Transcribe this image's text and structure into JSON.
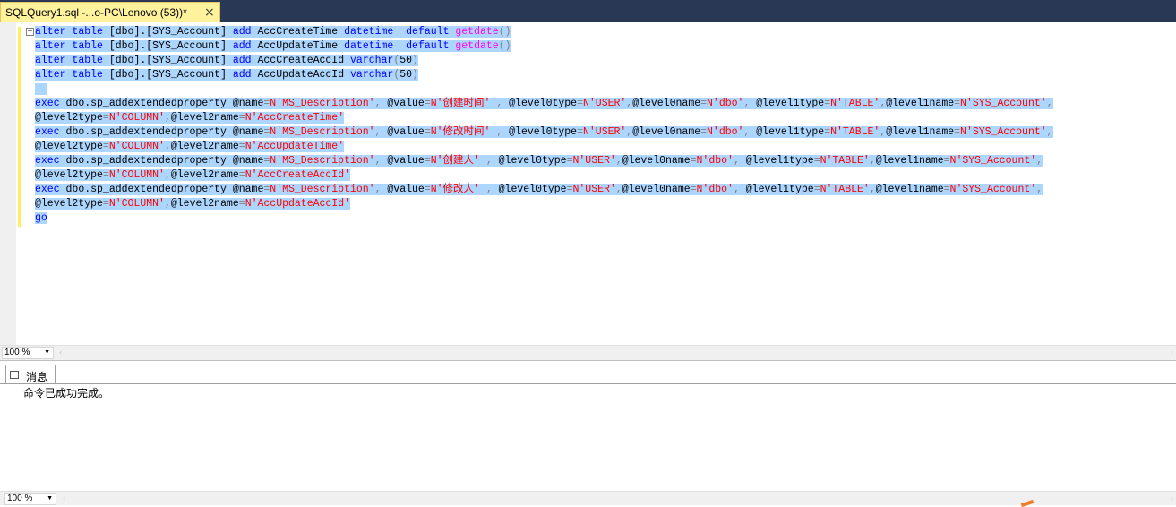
{
  "tab": {
    "title": "SQLQuery1.sql -...o-PC\\Lenovo (53))*",
    "close_glyph": "×"
  },
  "code_lines": [
    [
      [
        "kw",
        "alter"
      ],
      [
        "t",
        " "
      ],
      [
        "kw",
        "table"
      ],
      [
        "t",
        " [dbo]."
      ],
      [
        "t",
        "[SYS_Account] "
      ],
      [
        "kw",
        "add"
      ],
      [
        "t",
        " AccCreateTime "
      ],
      [
        "kw",
        "datetime"
      ],
      [
        "t",
        "  "
      ],
      [
        "kw",
        "default"
      ],
      [
        "t",
        " "
      ],
      [
        "fn",
        "getdate"
      ],
      [
        "op",
        "()"
      ]
    ],
    [
      [
        "kw",
        "alter"
      ],
      [
        "t",
        " "
      ],
      [
        "kw",
        "table"
      ],
      [
        "t",
        " [dbo]."
      ],
      [
        "t",
        "[SYS_Account] "
      ],
      [
        "kw",
        "add"
      ],
      [
        "t",
        " AccUpdateTime "
      ],
      [
        "kw",
        "datetime"
      ],
      [
        "t",
        "  "
      ],
      [
        "kw",
        "default"
      ],
      [
        "t",
        " "
      ],
      [
        "fn",
        "getdate"
      ],
      [
        "op",
        "()"
      ]
    ],
    [
      [
        "kw",
        "alter"
      ],
      [
        "t",
        " "
      ],
      [
        "kw",
        "table"
      ],
      [
        "t",
        " [dbo]."
      ],
      [
        "t",
        "[SYS_Account] "
      ],
      [
        "kw",
        "add"
      ],
      [
        "t",
        " AccCreateAccId "
      ],
      [
        "kw",
        "varchar"
      ],
      [
        "op",
        "("
      ],
      [
        "t",
        "50"
      ],
      [
        "op",
        ")"
      ]
    ],
    [
      [
        "kw",
        "alter"
      ],
      [
        "t",
        " "
      ],
      [
        "kw",
        "table"
      ],
      [
        "t",
        " [dbo]."
      ],
      [
        "t",
        "[SYS_Account] "
      ],
      [
        "kw",
        "add"
      ],
      [
        "t",
        " AccUpdateAccId "
      ],
      [
        "kw",
        "varchar"
      ],
      [
        "op",
        "("
      ],
      [
        "t",
        "50"
      ],
      [
        "op",
        ")"
      ]
    ],
    [
      [
        "t",
        "  "
      ]
    ],
    [
      [
        "kw",
        "exec"
      ],
      [
        "t",
        " dbo.sp_addextendedproperty @name"
      ],
      [
        "op",
        "="
      ],
      [
        "str",
        "N'MS_Description'"
      ],
      [
        "op",
        ", "
      ],
      [
        "t",
        "@value"
      ],
      [
        "op",
        "="
      ],
      [
        "str",
        "N'创建时间'"
      ],
      [
        "op",
        " , "
      ],
      [
        "t",
        "@level0type"
      ],
      [
        "op",
        "="
      ],
      [
        "str",
        "N'USER'"
      ],
      [
        "op",
        ","
      ],
      [
        "t",
        "@level0name"
      ],
      [
        "op",
        "="
      ],
      [
        "str",
        "N'dbo'"
      ],
      [
        "op",
        ", "
      ],
      [
        "t",
        "@level1type"
      ],
      [
        "op",
        "="
      ],
      [
        "str",
        "N'TABLE'"
      ],
      [
        "op",
        ","
      ],
      [
        "t",
        "@level1name"
      ],
      [
        "op",
        "="
      ],
      [
        "str",
        "N'SYS_Account'"
      ],
      [
        "op",
        ","
      ]
    ],
    [
      [
        "t",
        "@level2type"
      ],
      [
        "op",
        "="
      ],
      [
        "str",
        "N'COLUMN'"
      ],
      [
        "op",
        ","
      ],
      [
        "t",
        "@level2name"
      ],
      [
        "op",
        "="
      ],
      [
        "str",
        "N'AccCreateTime'"
      ]
    ],
    [
      [
        "kw",
        "exec"
      ],
      [
        "t",
        " dbo.sp_addextendedproperty @name"
      ],
      [
        "op",
        "="
      ],
      [
        "str",
        "N'MS_Description'"
      ],
      [
        "op",
        ", "
      ],
      [
        "t",
        "@value"
      ],
      [
        "op",
        "="
      ],
      [
        "str",
        "N'修改时间'"
      ],
      [
        "op",
        " , "
      ],
      [
        "t",
        "@level0type"
      ],
      [
        "op",
        "="
      ],
      [
        "str",
        "N'USER'"
      ],
      [
        "op",
        ","
      ],
      [
        "t",
        "@level0name"
      ],
      [
        "op",
        "="
      ],
      [
        "str",
        "N'dbo'"
      ],
      [
        "op",
        ", "
      ],
      [
        "t",
        "@level1type"
      ],
      [
        "op",
        "="
      ],
      [
        "str",
        "N'TABLE'"
      ],
      [
        "op",
        ","
      ],
      [
        "t",
        "@level1name"
      ],
      [
        "op",
        "="
      ],
      [
        "str",
        "N'SYS_Account'"
      ],
      [
        "op",
        ","
      ]
    ],
    [
      [
        "t",
        "@level2type"
      ],
      [
        "op",
        "="
      ],
      [
        "str",
        "N'COLUMN'"
      ],
      [
        "op",
        ","
      ],
      [
        "t",
        "@level2name"
      ],
      [
        "op",
        "="
      ],
      [
        "str",
        "N'AccUpdateTime'"
      ]
    ],
    [
      [
        "kw",
        "exec"
      ],
      [
        "t",
        " dbo.sp_addextendedproperty @name"
      ],
      [
        "op",
        "="
      ],
      [
        "str",
        "N'MS_Description'"
      ],
      [
        "op",
        ", "
      ],
      [
        "t",
        "@value"
      ],
      [
        "op",
        "="
      ],
      [
        "str",
        "N'创建人'"
      ],
      [
        "op",
        " , "
      ],
      [
        "t",
        "@level0type"
      ],
      [
        "op",
        "="
      ],
      [
        "str",
        "N'USER'"
      ],
      [
        "op",
        ","
      ],
      [
        "t",
        "@level0name"
      ],
      [
        "op",
        "="
      ],
      [
        "str",
        "N'dbo'"
      ],
      [
        "op",
        ", "
      ],
      [
        "t",
        "@level1type"
      ],
      [
        "op",
        "="
      ],
      [
        "str",
        "N'TABLE'"
      ],
      [
        "op",
        ","
      ],
      [
        "t",
        "@level1name"
      ],
      [
        "op",
        "="
      ],
      [
        "str",
        "N'SYS_Account'"
      ],
      [
        "op",
        ","
      ]
    ],
    [
      [
        "t",
        "@level2type"
      ],
      [
        "op",
        "="
      ],
      [
        "str",
        "N'COLUMN'"
      ],
      [
        "op",
        ","
      ],
      [
        "t",
        "@level2name"
      ],
      [
        "op",
        "="
      ],
      [
        "str",
        "N'AccCreateAccId'"
      ]
    ],
    [
      [
        "kw",
        "exec"
      ],
      [
        "t",
        " dbo.sp_addextendedproperty @name"
      ],
      [
        "op",
        "="
      ],
      [
        "str",
        "N'MS_Description'"
      ],
      [
        "op",
        ", "
      ],
      [
        "t",
        "@value"
      ],
      [
        "op",
        "="
      ],
      [
        "str",
        "N'修改人'"
      ],
      [
        "op",
        " , "
      ],
      [
        "t",
        "@level0type"
      ],
      [
        "op",
        "="
      ],
      [
        "str",
        "N'USER'"
      ],
      [
        "op",
        ","
      ],
      [
        "t",
        "@level0name"
      ],
      [
        "op",
        "="
      ],
      [
        "str",
        "N'dbo'"
      ],
      [
        "op",
        ", "
      ],
      [
        "t",
        "@level1type"
      ],
      [
        "op",
        "="
      ],
      [
        "str",
        "N'TABLE'"
      ],
      [
        "op",
        ","
      ],
      [
        "t",
        "@level1name"
      ],
      [
        "op",
        "="
      ],
      [
        "str",
        "N'SYS_Account'"
      ],
      [
        "op",
        ","
      ]
    ],
    [
      [
        "t",
        "@level2type"
      ],
      [
        "op",
        "="
      ],
      [
        "str",
        "N'COLUMN'"
      ],
      [
        "op",
        ","
      ],
      [
        "t",
        "@level2name"
      ],
      [
        "op",
        "="
      ],
      [
        "str",
        "N'AccUpdateAccId'"
      ]
    ],
    [
      [
        "kw",
        "go"
      ]
    ]
  ],
  "editor": {
    "zoom": "100 %",
    "outline_glyph": "−"
  },
  "results": {
    "tab_label": "消息",
    "message": "命令已成功完成。",
    "zoom": "100 %"
  },
  "scroll": {
    "left_glyph": "‹",
    "right_glyph": "›",
    "dd_glyph": "▼"
  },
  "colors": {
    "keyword": "#0000ff",
    "function": "#ff00ff",
    "string": "#ff0000",
    "operator": "#808080",
    "selection": "#add6ff",
    "titlebar": "#293955",
    "active_tab": "#fff29d"
  }
}
